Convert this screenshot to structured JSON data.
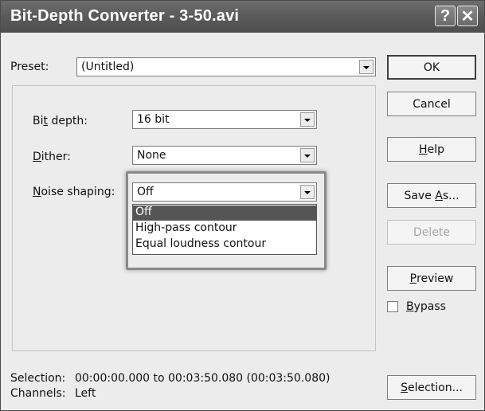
{
  "window": {
    "title": "Bit-Depth Converter - 3-50.avi",
    "help_glyph": "?",
    "close_glyph": "✕"
  },
  "preset": {
    "label": "Preset:",
    "value": "(Untitled)"
  },
  "fields": {
    "bit_depth": {
      "label_pre": "Bi",
      "label_u": "t",
      "label_post": " depth:",
      "value": "16 bit"
    },
    "dither": {
      "label_pre": "",
      "label_u": "D",
      "label_post": "ither:",
      "value": "None"
    },
    "noise_shaping": {
      "label_pre": "",
      "label_u": "N",
      "label_post": "oise shaping:",
      "value": "Off",
      "options": [
        "Off",
        "High-pass contour",
        "Equal loudness contour"
      ],
      "selected_index": 0
    }
  },
  "buttons": {
    "ok": "OK",
    "cancel": "Cancel",
    "help_pre": "",
    "help_u": "H",
    "help_post": "elp",
    "save_as_pre": "Save ",
    "save_as_u": "A",
    "save_as_post": "s...",
    "delete": "Delete",
    "preview_pre": "",
    "preview_u": "P",
    "preview_post": "review",
    "selection_pre": "",
    "selection_u": "S",
    "selection_post": "election..."
  },
  "bypass": {
    "label_pre": "",
    "label_u": "B",
    "label_post": "ypass",
    "checked": false
  },
  "status": {
    "selection_label": "Selection:",
    "selection_value": "00:00:00.000 to 00:03:50.080 (00:03:50.080)",
    "channels_label": "Channels:",
    "channels_value": "Left"
  }
}
